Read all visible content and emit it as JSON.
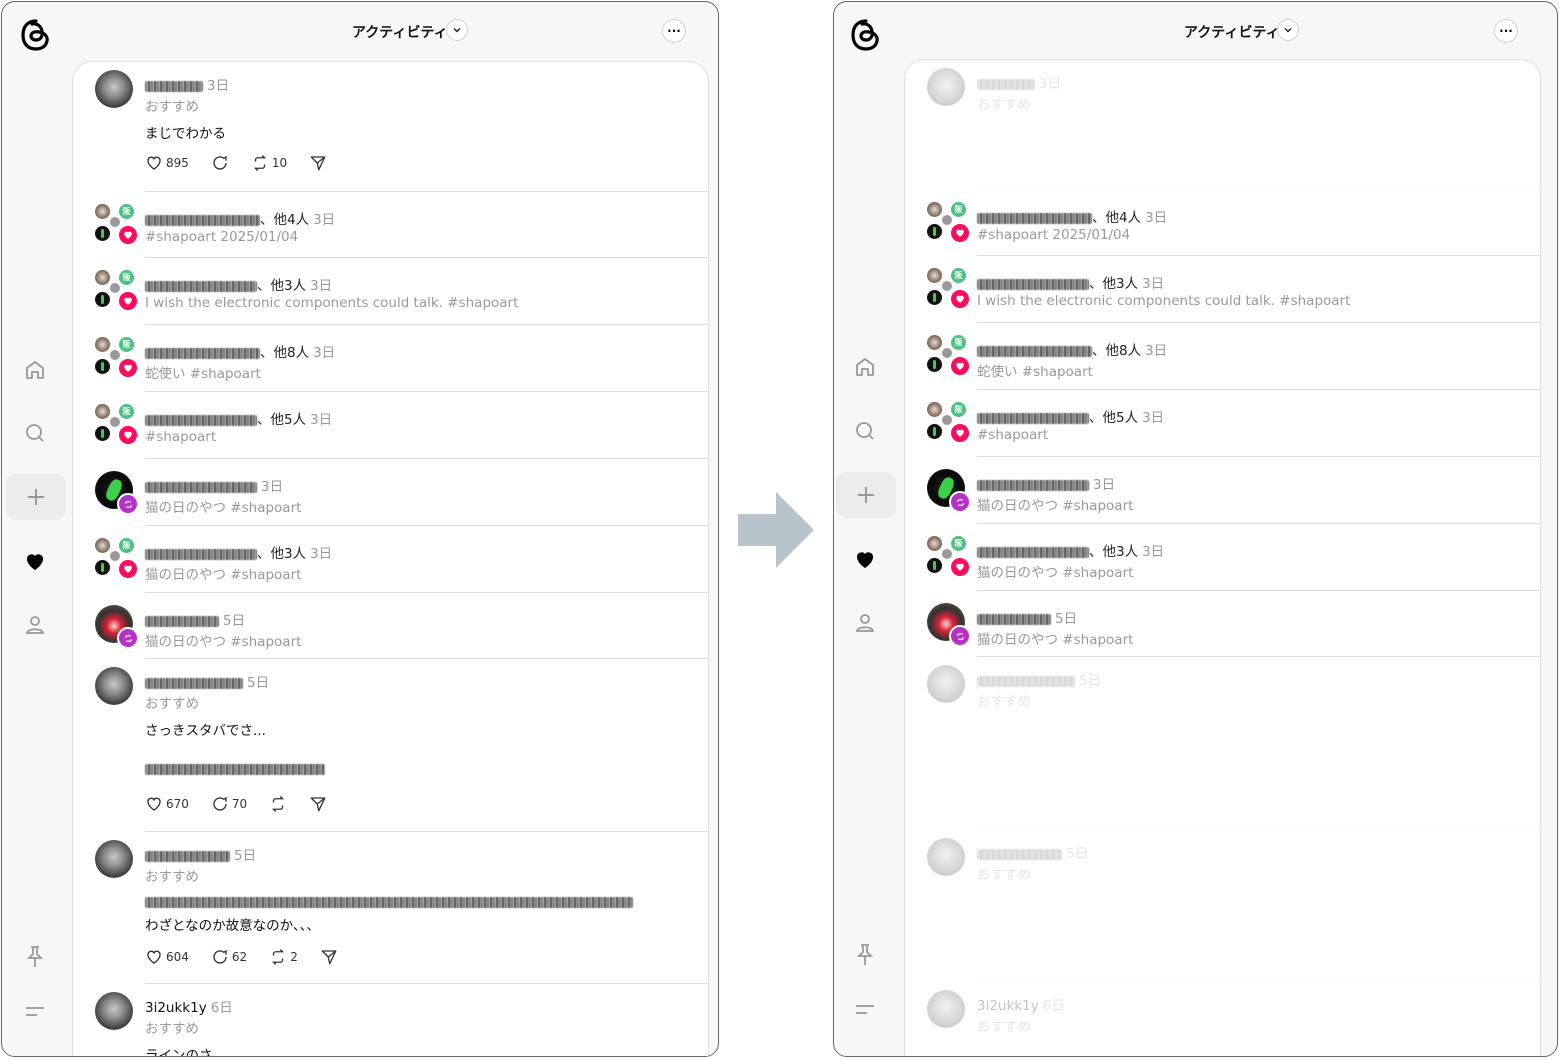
{
  "header": {
    "title": "アクティビティ"
  },
  "nav": {
    "items": [
      "home",
      "search",
      "new",
      "activity",
      "profile"
    ]
  },
  "feed_left": [
    {
      "kind": "post",
      "avatar": "gray",
      "user_rest": "",
      "time": "3日",
      "sub": "おすすめ",
      "body": [
        "まじでわかる"
      ],
      "likes": "895",
      "replies": "",
      "reposts": "10"
    },
    {
      "kind": "activity",
      "badge": "like",
      "user_rest": "、他4人",
      "time": "3日",
      "text": "#shapoart 2025/01/04"
    },
    {
      "kind": "activity",
      "badge": "like",
      "user_rest": "、他3人",
      "time": "3日",
      "text": "I wish the electronic components could talk. #shapoart"
    },
    {
      "kind": "activity",
      "badge": "like",
      "user_rest": "、他8人",
      "time": "3日",
      "text": "蛇使い #shapoart"
    },
    {
      "kind": "activity",
      "badge": "like",
      "user_rest": "、他5人",
      "time": "3日",
      "text": "#shapoart"
    },
    {
      "kind": "single",
      "badge": "repost",
      "avatar": "green",
      "user_rest": "",
      "time": "3日",
      "text": "猫の日のやつ #shapoart"
    },
    {
      "kind": "activity",
      "badge": "like",
      "user_rest": "、他3人",
      "time": "3日",
      "text": "猫の日のやつ #shapoart"
    },
    {
      "kind": "single",
      "badge": "repost",
      "avatar": "red",
      "user_rest": "",
      "time": "5日",
      "text": "猫の日のやつ #shapoart"
    },
    {
      "kind": "post",
      "avatar": "gray",
      "user_rest": "",
      "time": "5日",
      "sub": "おすすめ",
      "body": [
        "さっきスタバでさ...",
        "(blurred)"
      ],
      "likes": "670",
      "replies": "70",
      "reposts": ""
    },
    {
      "kind": "post",
      "avatar": "gray",
      "user_rest": "",
      "time": "5日",
      "sub": "おすすめ",
      "body": [
        "(blurred)",
        "わざとなのか故意なのか、、、"
      ],
      "likes": "604",
      "replies": "62",
      "reposts": "2"
    },
    {
      "kind": "post",
      "avatar": "gray",
      "user": "3i2ukk1y",
      "time": "6日",
      "sub": "おすすめ",
      "body": [
        "ラインのさ"
      ]
    }
  ],
  "labels": {
    "cl_b": "阪",
    "arrow": "→"
  }
}
